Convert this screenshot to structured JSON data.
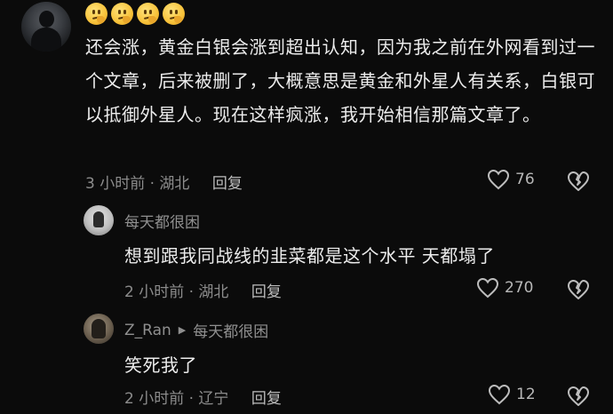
{
  "comments": [
    {
      "text": "还会涨，黄金白银会涨到超出认知，因为我之前在外网看到过一个文章，后来被删了，大概意思是黄金和外星人有关系，白银可以抵御外星人。现在这样疯涨，我开始相信那篇文章了。",
      "emoji_count": 4,
      "emoji_icon": "thinking-face-icon",
      "time_location": "3 小时前 · 湖北",
      "reply_label": "回复",
      "likes": "76"
    }
  ],
  "replies": [
    {
      "username": "每天都很困",
      "text": "想到跟我同战线的韭菜都是这个水平 天都塌了",
      "time_location": "2 小时前 · 湖北",
      "reply_label": "回复",
      "likes": "270"
    },
    {
      "username": "Z_Ran",
      "reply_to": "每天都很困",
      "text": "笑死我了",
      "time_location": "2 小时前 · 辽宁",
      "reply_label": "回复",
      "likes": "12"
    }
  ],
  "colors": {
    "background": "#0b0b0b",
    "text": "#ececec",
    "meta": "#8c8c8c"
  }
}
